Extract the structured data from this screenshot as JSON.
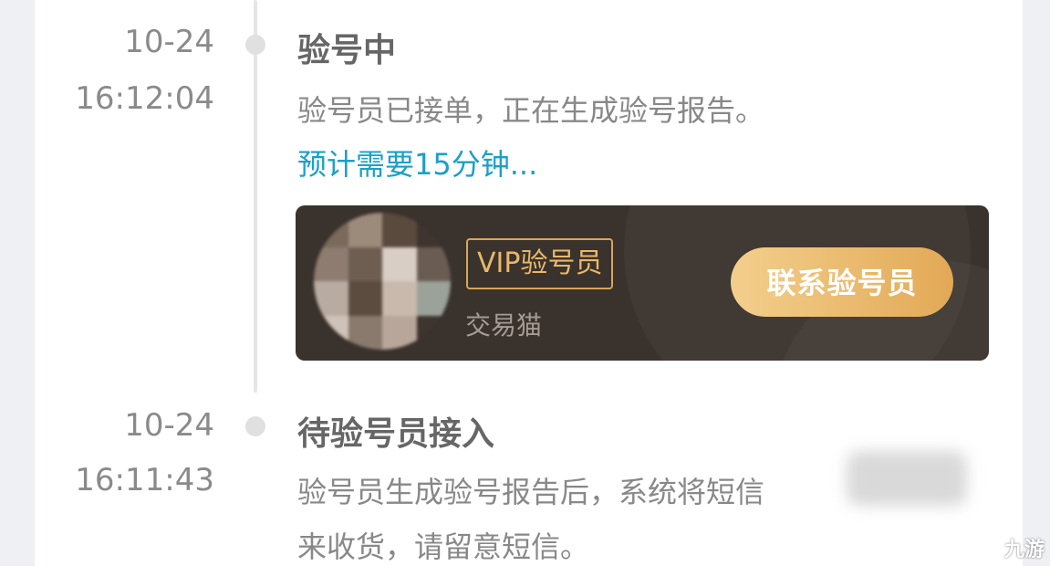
{
  "colors": {
    "accent_link": "#1aa0c8",
    "inspector_bg": "#3a322d",
    "badge_gold": "#d6a65a",
    "button_gradient_start": "#f3cf8c",
    "button_gradient_end": "#e2a956"
  },
  "timeline": [
    {
      "date": "10-24",
      "time": "16:12:04",
      "title": "验号中",
      "description": "验号员已接单，正在生成验号报告。",
      "estimate": "预计需要15分钟...",
      "inspector": {
        "avatar_icon": "avatar-icon",
        "badge": "VIP验号员",
        "company": "交易猫",
        "contact_button": "联系验号员"
      }
    },
    {
      "date": "10-24",
      "time": "16:11:43",
      "title": "待验号员接入",
      "description_line1": "验号员生成验号报告后，系统将短信",
      "description_line2": "来收货，请留意短信。"
    }
  ],
  "watermark": {
    "text": "九游"
  }
}
